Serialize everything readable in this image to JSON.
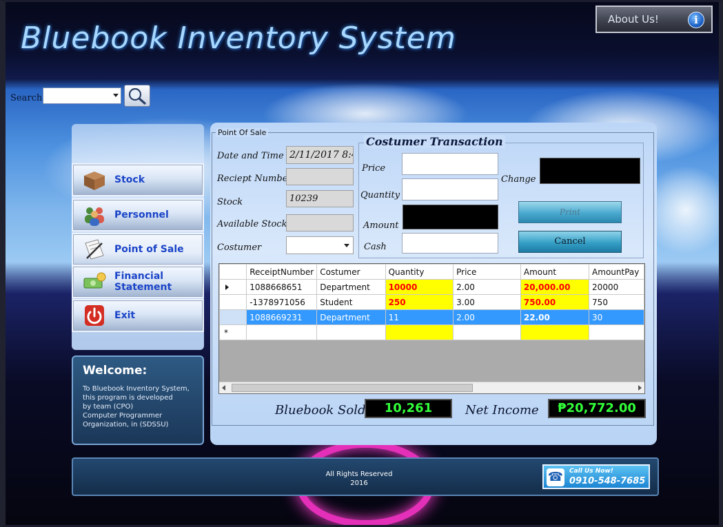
{
  "window": {
    "title": "Bluebook Inventory System"
  },
  "about": {
    "label": "About Us!",
    "icon": "info-icon"
  },
  "search": {
    "label": "Search",
    "value": "",
    "icon": "magnifier-icon"
  },
  "nav": [
    {
      "label": "Stock",
      "icon": "box-icon"
    },
    {
      "label": "Personnel",
      "icon": "people-icon"
    },
    {
      "label": "Point of Sale",
      "icon": "receipt-pen-icon"
    },
    {
      "label": "Financial Statement",
      "icon": "money-icon"
    },
    {
      "label": "Exit",
      "icon": "power-icon"
    }
  ],
  "welcome": {
    "title": "Welcome:",
    "lines": [
      "To Bluebook Inventory System,",
      " this program is developed",
      " by team (CPO)",
      "Computer Programmer",
      "Organization, in (SDSSU)"
    ]
  },
  "pos": {
    "legend": "Point Of Sale",
    "date_label": "Date and Time",
    "date_value": "2/11/2017 8:4",
    "receipt_label": "Reciept Number",
    "receipt_value": "",
    "stock_label": "Stock",
    "stock_value": "10239",
    "available_label": "Available Stock",
    "available_value": "",
    "customer_label": "Costumer",
    "customer_value": ""
  },
  "transaction": {
    "legend": "Costumer Transaction",
    "price_label": "Price",
    "quantity_label": "Quantity",
    "amount_label": "Amount",
    "cash_label": "Cash",
    "change_label": "Change",
    "price_value": "",
    "quantity_value": "",
    "cash_value": "",
    "print_label": "Print",
    "cancel_label": "Cancel"
  },
  "grid": {
    "columns": [
      "ReceiptNumber",
      "Costumer",
      "Quantity",
      "Price",
      "Amount",
      "AmountPay"
    ],
    "rows": [
      [
        "1088668651",
        "Department",
        "10000",
        "2.00",
        "20,000.00",
        "20000"
      ],
      [
        "-1378971056",
        "Student",
        "250",
        "3.00",
        "750.00",
        "750"
      ],
      [
        "1088669231",
        "Department",
        "11",
        "2.00",
        "22.00",
        "30"
      ]
    ],
    "new_row_marker": "*"
  },
  "summary": {
    "sold_label": "Bluebook Sold",
    "sold_value": "10,261",
    "income_label": "Net Income",
    "income_value": "₱20,772.00"
  },
  "footer": {
    "line1": "All Rights Reserved",
    "line2": "2016",
    "call_label": "Call Us Now!",
    "call_number": "0910-548-7685"
  },
  "colors": {
    "highlight_cell": "#ffff00",
    "highlight_text": "#ff0000",
    "selected_row": "#3399ff",
    "summary_text": "#32ff3a"
  }
}
